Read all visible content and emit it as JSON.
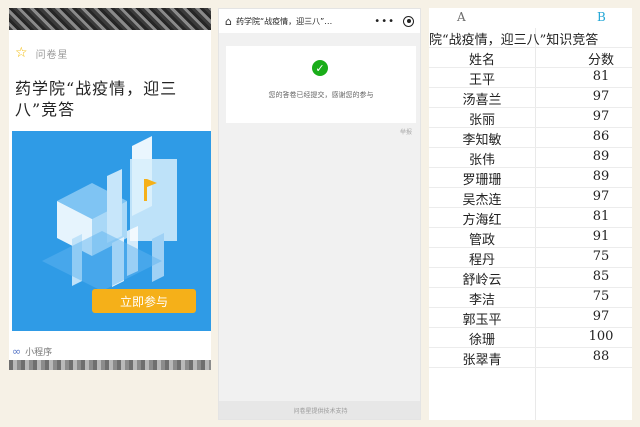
{
  "share_card": {
    "source_name": "问卷星",
    "title": "药学院“战疫情，迎三八”竞答",
    "join_button": "立即参与",
    "mini_program_label": "小程序"
  },
  "result_page": {
    "nav_title": "药学院“战疫情，迎三八”…",
    "message": "您的答卷已经提交，感谢您的参与",
    "report_link": "举报",
    "footer": "问卷星提供技术支持"
  },
  "sheet": {
    "columns": [
      "A",
      "B"
    ],
    "title": "院“战疫情，迎三八”知识竞答",
    "headers": {
      "name": "姓名",
      "score": "分数"
    },
    "rows": [
      {
        "name": "王平",
        "score": "81"
      },
      {
        "name": "汤喜兰",
        "score": "97"
      },
      {
        "name": "张丽",
        "score": "97"
      },
      {
        "name": "李知敏",
        "score": "86"
      },
      {
        "name": "张伟",
        "score": "89"
      },
      {
        "name": "罗珊珊",
        "score": "89"
      },
      {
        "name": "吴杰连",
        "score": "97"
      },
      {
        "name": "方海红",
        "score": "81"
      },
      {
        "name": "管政",
        "score": "91"
      },
      {
        "name": "程丹",
        "score": "75"
      },
      {
        "name": "舒岭云",
        "score": "85"
      },
      {
        "name": "李洁",
        "score": "75"
      },
      {
        "name": "郭玉平",
        "score": "97"
      },
      {
        "name": "徐珊",
        "score": "100"
      },
      {
        "name": "张翠青",
        "score": "88"
      }
    ]
  },
  "colors": {
    "accent_orange": "#f5b019",
    "banner_blue": "#2f9be6",
    "success_green": "#1aad19",
    "column_b": "#25a7d6"
  }
}
